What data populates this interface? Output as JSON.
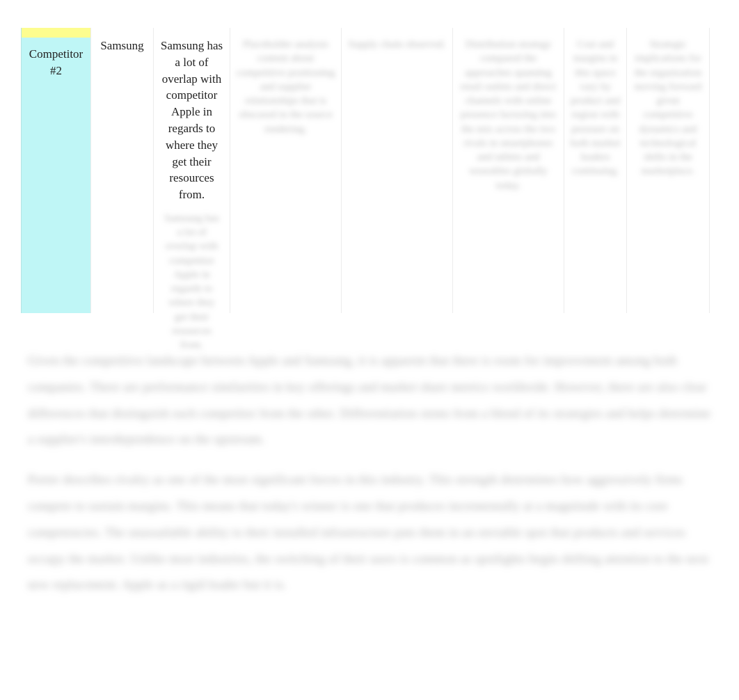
{
  "table": {
    "rowLabel": "Competitor #2",
    "cells": {
      "company": "Samsung",
      "overlap": "Samsung has a lot of overlap with competitor Apple in regards to where they get their resources from.",
      "overlap_sub_blur": "Samsung has a lot of overlap with competitor Apple in regards to where they get their resources from.",
      "col3_blur": "Placeholder analysis content about competitive positioning and supplier relationships that is obscured in the source rendering.",
      "col4_blur": "Supply chain observed.",
      "col5_blur": "Distribution strategy compared the approaches spanning retail outlets and direct channels with online presence factoring into the mix across the two rivals in smartphones and tablets and wearables globally today.",
      "col6_blur": "Cost and margins in this space vary by product and region with pressure on both market leaders continuing.",
      "col7_blur": "Strategic implications for the organization moving forward given competitive dynamics and technological shifts in the marketplace."
    }
  },
  "paragraphs": {
    "p1": "Given the competitive landscape between Apple and Samsung, it is apparent that there is room for improvement among both companies. There are performance similarities in key offerings and market share metrics worldwide. However, there are also clear differences that distinguish each competitor from the other. Differentiation stems from a blend of its strategies and helps determine a supplier's interdependence on the upstream.",
    "p2": "Porter describes rivalry as one of the most significant forces in this industry. This strength determines how aggressively firms compete to sustain margins. This means that today's winner is one that produces incrementally at a magnitude with its core competencies. The unassailable ability to their installed infrastructure puts them in an enviable spot that products and services occupy the market. Unlike most industries, the switching of their users is common as spotlights begin shifting attention to the next new replacement. Apple as a rigid leader but it is."
  }
}
